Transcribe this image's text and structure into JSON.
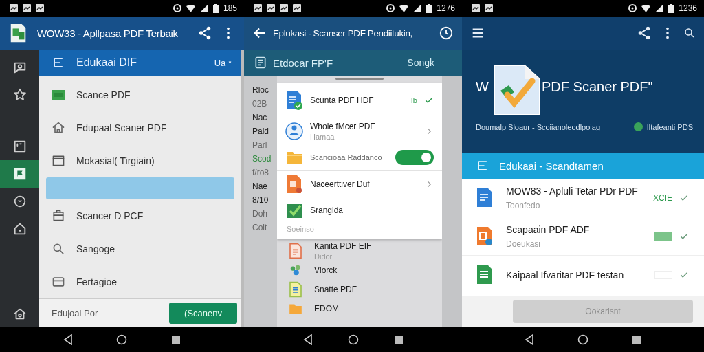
{
  "screen_1": {
    "status_time": "185",
    "title": "WOW33 - Apllpasa PDF Terbaik",
    "rail": [
      {
        "selected": false
      },
      {
        "selected": false
      },
      {
        "selected": false
      },
      {
        "selected": true
      },
      {
        "selected": false
      },
      {
        "selected": false
      },
      {
        "selected": false
      }
    ],
    "panel_title": "Edukaai DIF",
    "panel_badge": "Ua *",
    "menu": [
      {
        "kind": "item",
        "label": "Scance PDF"
      },
      {
        "kind": "item",
        "label": "Edupaal Scaner PDF"
      },
      {
        "kind": "item",
        "label": "Mokasial( Tirgiain)"
      },
      {
        "kind": "highlight"
      },
      {
        "kind": "item",
        "label": "Scancer D PCF"
      },
      {
        "kind": "item",
        "label": "Sangoge"
      },
      {
        "kind": "item",
        "label": "Fertagioe"
      }
    ],
    "footer_text": "Edujoai Por",
    "footer_button": "(Scanenv"
  },
  "screen_2": {
    "status_time": "1276",
    "title": "Eplukasi - Scanser PDF Pendiitukin,",
    "header_title": "Etdocar FP'F",
    "header_action": "Songk",
    "peek": [
      {
        "kind": "title",
        "text": "Rloc"
      },
      {
        "kind": "sub",
        "text": "02B"
      },
      {
        "kind": "title",
        "text": "Nac"
      },
      {
        "kind": "title",
        "text": "Pald"
      },
      {
        "kind": "sub",
        "text": "Parl"
      },
      {
        "kind": "accent",
        "text": "Scod"
      },
      {
        "kind": "sub",
        "text": "f/ro8"
      },
      {
        "kind": "title",
        "text": "Nae"
      },
      {
        "kind": "title",
        "text": "8/10"
      },
      {
        "kind": "sub",
        "text": "Doh"
      },
      {
        "kind": "sub",
        "text": "Colt"
      }
    ],
    "sheet": [
      {
        "kind": "check",
        "title": "Scunta PDF HDF",
        "trail": "Ib"
      },
      {
        "kind": "nav",
        "title": "Whole fMcer PDF",
        "subtitle": "Hamaa"
      },
      {
        "kind": "toggle",
        "title": "Scancioaa Raddanco",
        "on": true
      },
      {
        "kind": "nav",
        "title": "Naceerttiver Duf"
      },
      {
        "kind": "plain",
        "title": "Sranglda"
      }
    ],
    "sheet_caption": "Soeinso",
    "list": [
      {
        "title": "Kanita PDF EIF",
        "subtitle": "Didor"
      },
      {
        "title": "Vlorck"
      },
      {
        "title": "Snatte PDF"
      },
      {
        "title": "EDOM"
      }
    ]
  },
  "screen_3": {
    "status_time": "1236",
    "hero_title_lead": "W",
    "hero_title": "PDF Scaner PDF\"",
    "hero_subtitle": "Doumalp Sloaur - Scoiianoleodlpoiag",
    "hero_badge": "Iltafeanti PDS",
    "section_title": "Edukaai - Scandtamen",
    "files": [
      {
        "title": "MOW83 - Apluli Tetar PDr PDF",
        "subtitle": "Toonfedo",
        "kind": "text",
        "trail": "XCIE",
        "checked": true
      },
      {
        "title": "Scapaain PDF ADF",
        "subtitle": "Doeukasi",
        "kind": "swatch",
        "checked": true
      },
      {
        "title": "Kaipaal Ifvaritar PDF testan",
        "kind": "empty",
        "checked": true
      }
    ],
    "button": {
      "label": "Ookarisnt",
      "disabled": true
    }
  }
}
